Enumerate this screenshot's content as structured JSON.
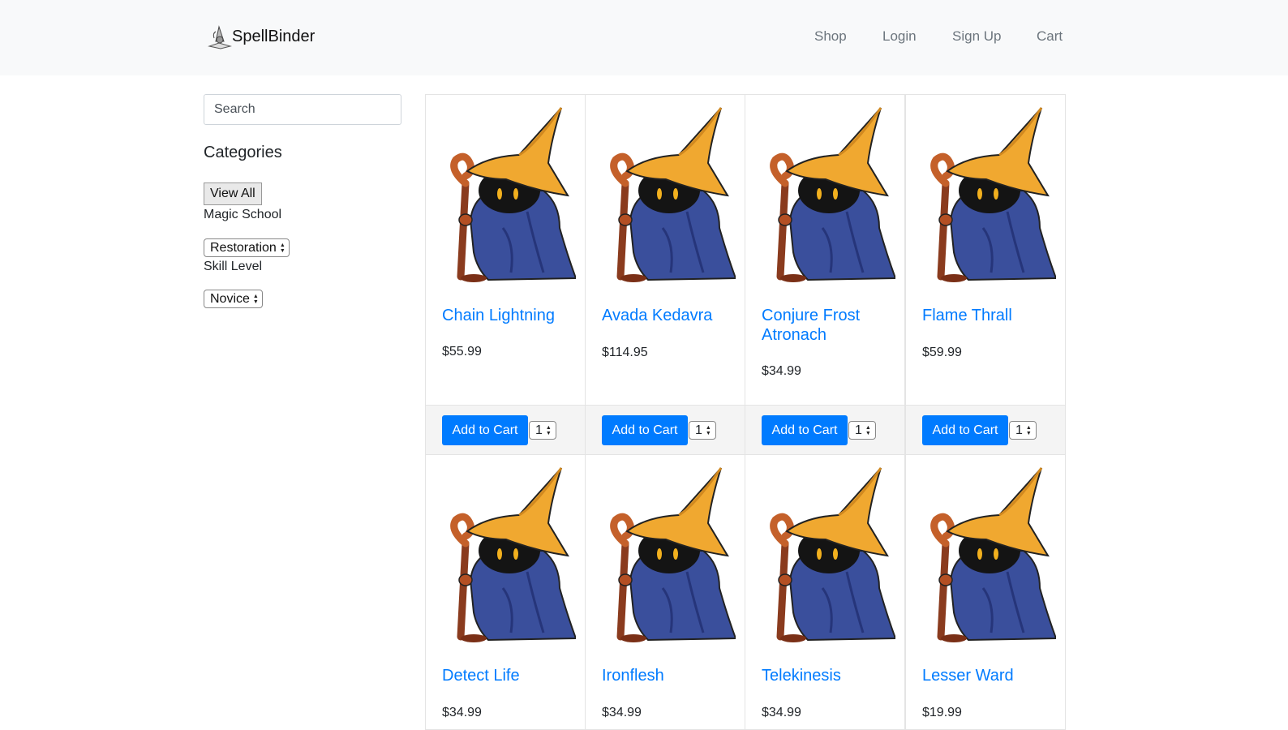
{
  "brand": {
    "name": "SpellBinder",
    "logo_icon": "wizard-book-icon"
  },
  "nav": {
    "items": [
      "Shop",
      "Login",
      "Sign Up",
      "Cart"
    ]
  },
  "sidebar": {
    "search_placeholder": "Search",
    "categories_title": "Categories",
    "view_all": "View All",
    "magic_school_label": "Magic School",
    "magic_school_value": "Restoration",
    "skill_level_label": "Skill Level",
    "skill_level_value": "Novice"
  },
  "products": [
    {
      "name": "Chain Lightning",
      "price": "$55.99",
      "button": "Add to Cart",
      "qty": "1"
    },
    {
      "name": "Avada Kedavra",
      "price": "$114.95",
      "button": "Add to Cart",
      "qty": "1"
    },
    {
      "name": "Conjure Frost Atronach",
      "price": "$34.99",
      "button": "Add to Cart",
      "qty": "1"
    },
    {
      "name": "Flame Thrall",
      "price": "$59.99",
      "button": "Add to Cart",
      "qty": "1"
    },
    {
      "name": "Detect Life",
      "price": "$34.99",
      "button": "Add to Cart",
      "qty": "1"
    },
    {
      "name": "Ironflesh",
      "price": "$34.99",
      "button": "Add to Cart",
      "qty": "1"
    },
    {
      "name": "Telekinesis",
      "price": "$34.99",
      "button": "Add to Cart",
      "qty": "1"
    },
    {
      "name": "Lesser Ward",
      "price": "$19.99",
      "button": "Add to Cart",
      "qty": "1"
    }
  ],
  "colors": {
    "link": "#007bff",
    "button": "#007bff",
    "navbar_bg": "#f8f9fa",
    "hat": "#f0a830",
    "robe": "#3a4f9c"
  }
}
